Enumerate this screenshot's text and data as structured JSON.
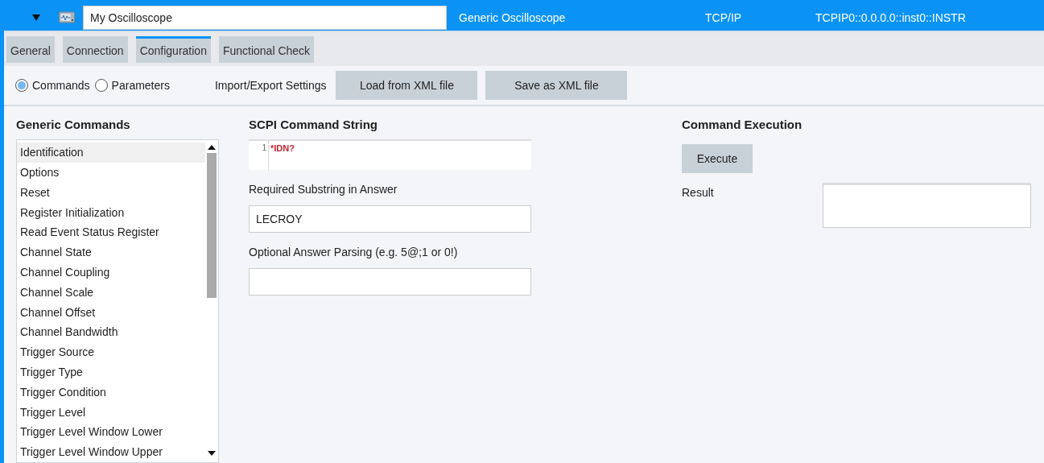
{
  "header": {
    "name": "My Oscilloscope",
    "type": "Generic Oscilloscope",
    "interface": "TCP/IP",
    "address": "TCPIP0::0.0.0.0::inst0::INSTR"
  },
  "tabs": [
    {
      "label": "General",
      "selected": false
    },
    {
      "label": "Connection",
      "selected": false
    },
    {
      "label": "Configuration",
      "selected": true
    },
    {
      "label": "Functional Check",
      "selected": false
    }
  ],
  "modes": [
    {
      "label": "Commands",
      "selected": true
    },
    {
      "label": "Parameters",
      "selected": false
    }
  ],
  "import_export": {
    "label": "Import/Export Settings",
    "buttons": [
      "Load from XML file",
      "Save as XML file"
    ]
  },
  "generic_commands": {
    "title": "Generic Commands",
    "items": [
      {
        "label": "Identification",
        "selected": true
      },
      {
        "label": "Options",
        "selected": false
      },
      {
        "label": "Reset",
        "selected": false
      },
      {
        "label": "Register Initialization",
        "selected": false
      },
      {
        "label": "Read Event Status Register",
        "selected": false
      },
      {
        "label": "Channel State",
        "selected": false
      },
      {
        "label": "Channel Coupling",
        "selected": false
      },
      {
        "label": "Channel Scale",
        "selected": false
      },
      {
        "label": "Channel Offset",
        "selected": false
      },
      {
        "label": "Channel Bandwidth",
        "selected": false
      },
      {
        "label": "Trigger Source",
        "selected": false
      },
      {
        "label": "Trigger Type",
        "selected": false
      },
      {
        "label": "Trigger Condition",
        "selected": false
      },
      {
        "label": "Trigger Level",
        "selected": false
      },
      {
        "label": "Trigger Level Window Lower",
        "selected": false
      },
      {
        "label": "Trigger Level Window Upper",
        "selected": false
      }
    ]
  },
  "scpi": {
    "title": "SCPI Command String",
    "line_number": "1",
    "command": "*IDN?",
    "required_label": "Required Substring in Answer",
    "required_value": "LECROY",
    "parsing_label": "Optional Answer Parsing (e.g. 5@;1 or 0!)"
  },
  "execution": {
    "title": "Command Execution",
    "button": "Execute",
    "result_label": "Result"
  }
}
